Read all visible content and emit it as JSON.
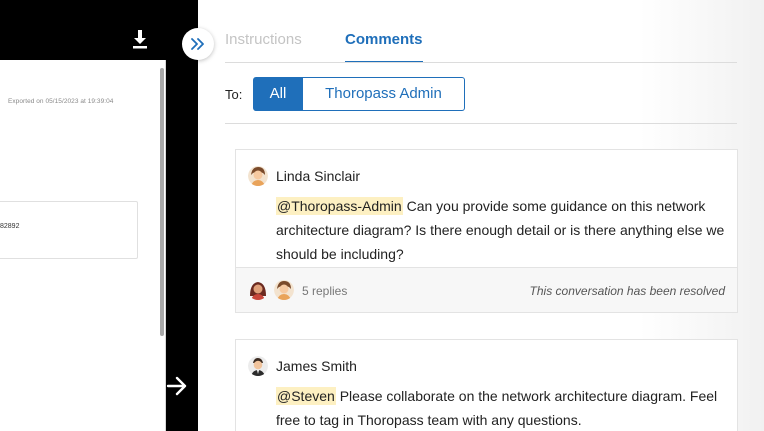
{
  "viewer": {
    "export_note": "Exported on 05/15/2023 at 19:39:04",
    "doc_id_fragment": "82892"
  },
  "tabs": [
    {
      "label": "Instructions",
      "active": false
    },
    {
      "label": "Comments",
      "active": true
    }
  ],
  "recipients": {
    "label": "To:",
    "options": [
      {
        "label": "All",
        "selected": true
      },
      {
        "label": "Thoropass Admin",
        "selected": false
      }
    ]
  },
  "comments": [
    {
      "author": "Linda Sinclair",
      "mention": "@Thoropass-Admin",
      "text": " Can you provide some guidance on this network architecture diagram? Is there enough detail or is there anything else we should be including?",
      "replies": "5 replies",
      "status": "This conversation has been resolved"
    },
    {
      "author": "James Smith",
      "mention": "@Steven",
      "text": " Please collaborate on the network architecture diagram. Feel free to tag in Thoropass team with any questions."
    }
  ],
  "colors": {
    "accent": "#1f6fba",
    "mention_highlight": "#fdf0c2",
    "viewer_bg": "#000000"
  }
}
